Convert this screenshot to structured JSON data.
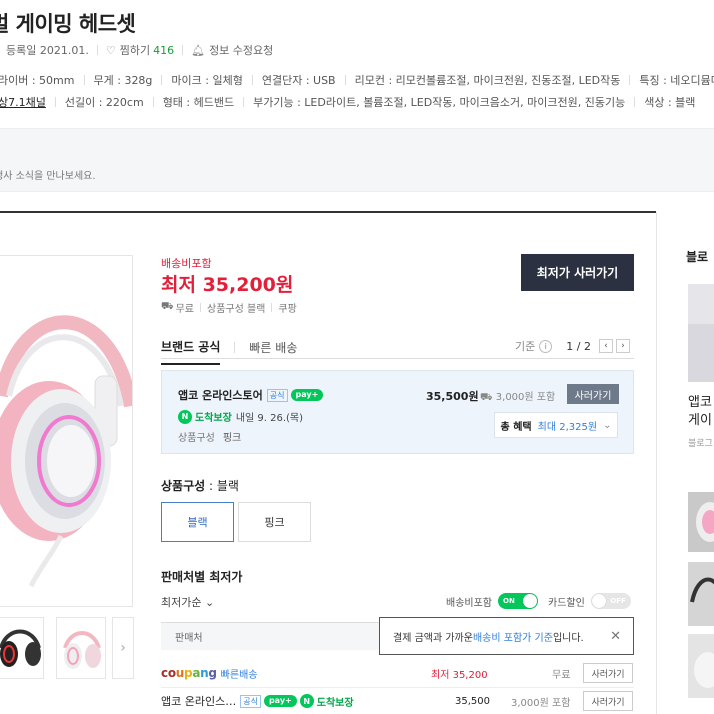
{
  "header": {
    "title": "벌 게이밍 헤드셋",
    "reg_date": "등록일 2021.01.",
    "like_label": "찜하기",
    "like_count": "416",
    "edit_request": "정보 수정요청"
  },
  "specs_row1": [
    "라이버 : 50mm",
    "무게 : 328g",
    "마이크 : 일체형",
    "연결단자 : USB",
    "리모컨 : 리모컨볼륨조절, 마이크전원, 진동조절, LED작동",
    "특징 : 네오디뮴마그넷"
  ],
  "specs_row2": [
    "상7.1채널",
    "선길이 : 220cm",
    "형태 : 헤드밴드",
    "부가기능 : LED라이트, 볼륨조절, LED작동, 마이크음소거, 마이크전원, 진동기능",
    "색상 : 블랙"
  ],
  "notice": "행사 소식을 만나보세요.",
  "price": {
    "ship_label": "배송비포함",
    "lowest": "최저 35,200원",
    "free": "무료",
    "config": "상품구성 블랙",
    "store": "쿠팡",
    "buy_lowest": "최저가 사러가기"
  },
  "tabs": {
    "brand": "브랜드 공식",
    "fast": "빠른 배송"
  },
  "pager": {
    "basis": "기준",
    "info": "i",
    "page": "1 / 2",
    "prev": "‹",
    "next": "›"
  },
  "seller": {
    "name": "앱코 온라인스토어",
    "official": "공식",
    "npay": "pay+",
    "n": "N",
    "arrive_label": "도착보장",
    "arrive_date": "내일 9. 26.(목)",
    "config_label": "상품구성",
    "config_value": "핑크",
    "price": "35,500원",
    "ship": "3,000원 포함",
    "buy": "사러가기",
    "benefit_label": "총 혜택",
    "benefit_value": "최대 2,325원",
    "chevron": "⌄"
  },
  "options": {
    "title_label": "상품구성",
    "title_value": " : 블랙",
    "items": [
      "블랙",
      "핑크"
    ]
  },
  "lowest_by_seller": {
    "title": "판매처별 최저가",
    "sort": "최저가순",
    "ship_incl": "배송비포함",
    "on": "ON",
    "card": "카드할인",
    "off": "OFF",
    "col_seller": "판매처"
  },
  "tooltip": {
    "pre": "결제 금액과 가까운 ",
    "link": "배송비 포함가 기준",
    "post": "입니다.",
    "close": "✕"
  },
  "rows": [
    {
      "seller": "coupang",
      "tag": "빠른배송",
      "price": "최저 35,200",
      "ship": "무료",
      "buy": "사러가기"
    },
    {
      "seller": "앱코 온라인스…",
      "official": "공식",
      "npay": "pay+",
      "arrive": "도착보장",
      "price": "35,500",
      "ship": "3,000원 포함",
      "buy": "사러가기"
    }
  ],
  "blog": {
    "title": "블로",
    "text1": "앱코",
    "text2": "게이",
    "sub": "블로그"
  },
  "colors": {
    "price_red": "#e2203a",
    "naver_green": "#03c75a",
    "dark_button": "#2b3140",
    "link_blue": "#2f7fd8"
  }
}
